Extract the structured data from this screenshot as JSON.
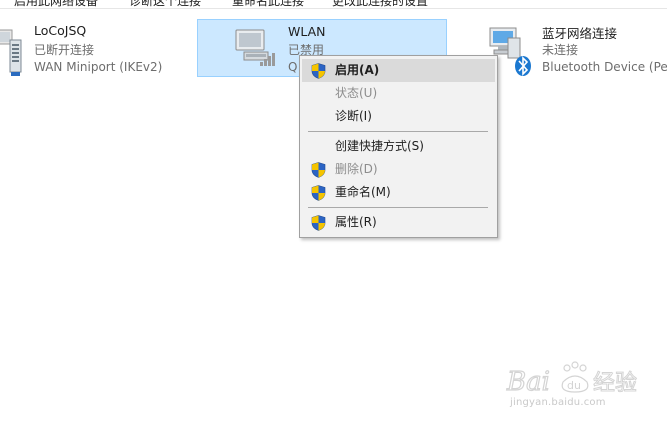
{
  "toolbar": {
    "items": [
      "启用此网络设备",
      "诊断这个连接",
      "重命名此连接",
      "更改此连接的设置"
    ]
  },
  "adapters": [
    {
      "name": "LoCoJSQ",
      "status": "已断开连接",
      "device": "WAN Miniport (IKEv2)",
      "icon": "network-adapter-icon"
    },
    {
      "name": "WLAN",
      "status": "已禁用",
      "device": "Q",
      "icon": "wireless-adapter-icon"
    },
    {
      "name": "蓝牙网络连接",
      "status": "未连接",
      "device": "Bluetooth Device (Per",
      "icon": "bluetooth-adapter-icon"
    }
  ],
  "context_menu": {
    "items": [
      {
        "label": "启用(A)",
        "icon": "uac-shield-icon",
        "state": "default"
      },
      {
        "label": "状态(U)",
        "state": "disabled"
      },
      {
        "label": "诊断(I)",
        "state": "normal"
      },
      {
        "label": "创建快捷方式(S)",
        "state": "normal"
      },
      {
        "label": "删除(D)",
        "icon": "uac-shield-icon",
        "state": "disabled"
      },
      {
        "label": "重命名(M)",
        "icon": "uac-shield-icon",
        "state": "normal"
      },
      {
        "label": "属性(R)",
        "icon": "uac-shield-icon",
        "state": "normal"
      }
    ]
  },
  "watermark": {
    "brand": "Baidu经验",
    "url": "jingyan.baidu.com"
  },
  "colors": {
    "selection_fill": "#cce8ff",
    "selection_border": "#99d1ff",
    "menu_bg": "#f2f2f2",
    "menu_highlight": "#dadada",
    "bluetooth_blue": "#1b78d0"
  }
}
